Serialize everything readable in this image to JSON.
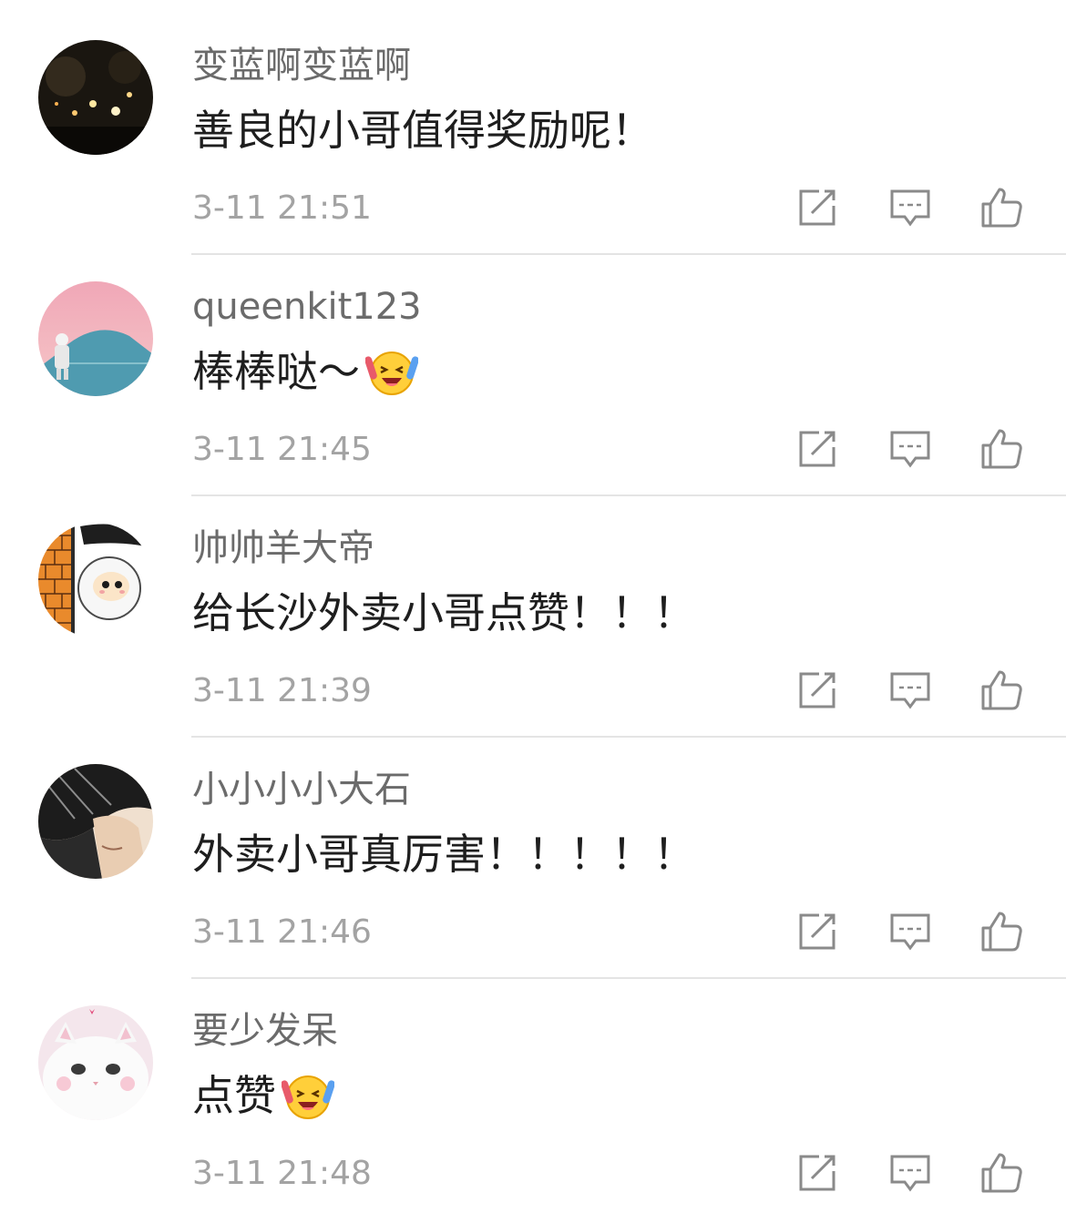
{
  "comments": [
    {
      "username": "变蓝啊变蓝啊",
      "text": "善良的小哥值得奖励呢！",
      "time": "3-11 21:51",
      "emoji": "",
      "avatar": "night-street-photo"
    },
    {
      "username": "queenkit123",
      "text": "棒棒哒～",
      "time": "3-11 21:45",
      "emoji": "laughing-crying-emoji",
      "avatar": "astronaut-pink-sky-photo"
    },
    {
      "username": "帅帅羊大帝",
      "text": "给长沙外卖小哥点赞！！！",
      "time": "3-11 21:39",
      "emoji": "",
      "avatar": "cartoon-sheep-meme"
    },
    {
      "username": "小小小小大石",
      "text": "外卖小哥真厉害！！！！！",
      "time": "3-11 21:46",
      "emoji": "",
      "avatar": "boy-portrait-photo"
    },
    {
      "username": "要少发呆",
      "text": "点赞",
      "time": "3-11 21:48",
      "emoji": "laughing-crying-emoji",
      "avatar": "white-cat-photo"
    }
  ],
  "icons": {
    "share": "share-edit-icon",
    "reply": "comment-bubble-icon",
    "like": "thumbs-up-icon"
  },
  "colors": {
    "username": "#6b6b6b",
    "text": "#1e1e1e",
    "time": "#a3a3a3",
    "icon": "#8a8a8a",
    "divider": "#e4e4e4"
  }
}
